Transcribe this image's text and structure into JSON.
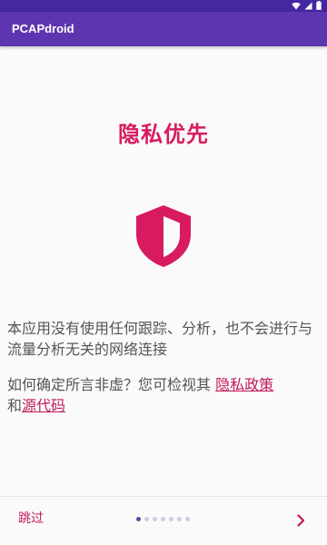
{
  "app": {
    "title": "PCAPdroid"
  },
  "slide": {
    "title": "隐私优先",
    "icon": "shield-half-icon",
    "paragraph1": "本应用没有使用任何跟踪、分析，也不会进行与流量分析无关的网络连接",
    "paragraph2_prefix": "如何确定所言非虚？您可检视其 ",
    "privacy_policy_link": "隐私政策",
    "and_text": "和",
    "source_code_link": "源代码"
  },
  "footer": {
    "skip_label": "跳过",
    "page_count": 7,
    "current_page": 1,
    "next_icon": "chevron-right-icon"
  },
  "colors": {
    "status_bar": "#4527a0",
    "app_bar": "#5e35b1",
    "accent": "#d81b60",
    "link": "#c2185b"
  }
}
